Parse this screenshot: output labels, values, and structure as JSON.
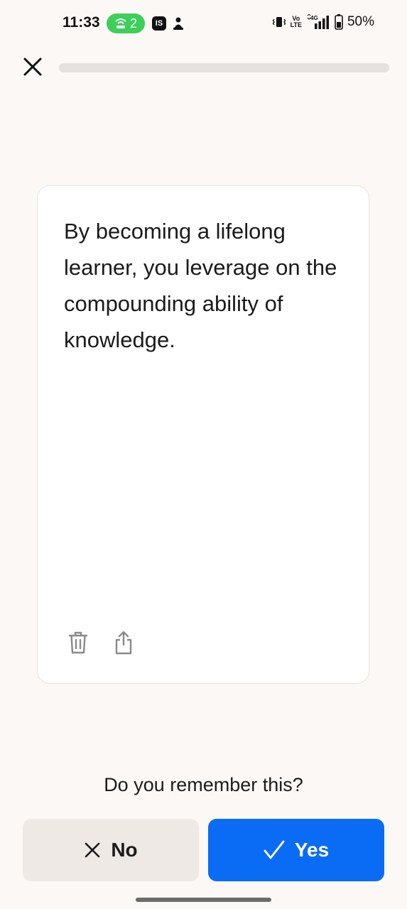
{
  "status_bar": {
    "time": "11:33",
    "hotspot_count": "2",
    "app_badge": "IS",
    "network_top": "Vo",
    "network_bottom": "LTE",
    "signal_label": "4G",
    "battery": "50%",
    "icons": [
      "hotspot-icon",
      "app-badge-icon",
      "notification-icon",
      "vibrate-icon",
      "volte-icon",
      "signal-icon",
      "battery-icon"
    ]
  },
  "header": {
    "close_icon": "close-icon",
    "progress": 0
  },
  "card": {
    "text": "By becoming a lifelong learner, you leverage on the compounding ability of knowledge.",
    "actions": [
      "trash-icon",
      "share-icon"
    ]
  },
  "question": "Do you remember this?",
  "buttons": {
    "no_label": "No",
    "yes_label": "Yes",
    "no_icon": "x-icon",
    "yes_icon": "check-icon"
  },
  "colors": {
    "background": "#fcf8f5",
    "accent": "#0a6cf5",
    "no_button": "#efe9e6",
    "hotspot_green": "#3ccf5a"
  }
}
